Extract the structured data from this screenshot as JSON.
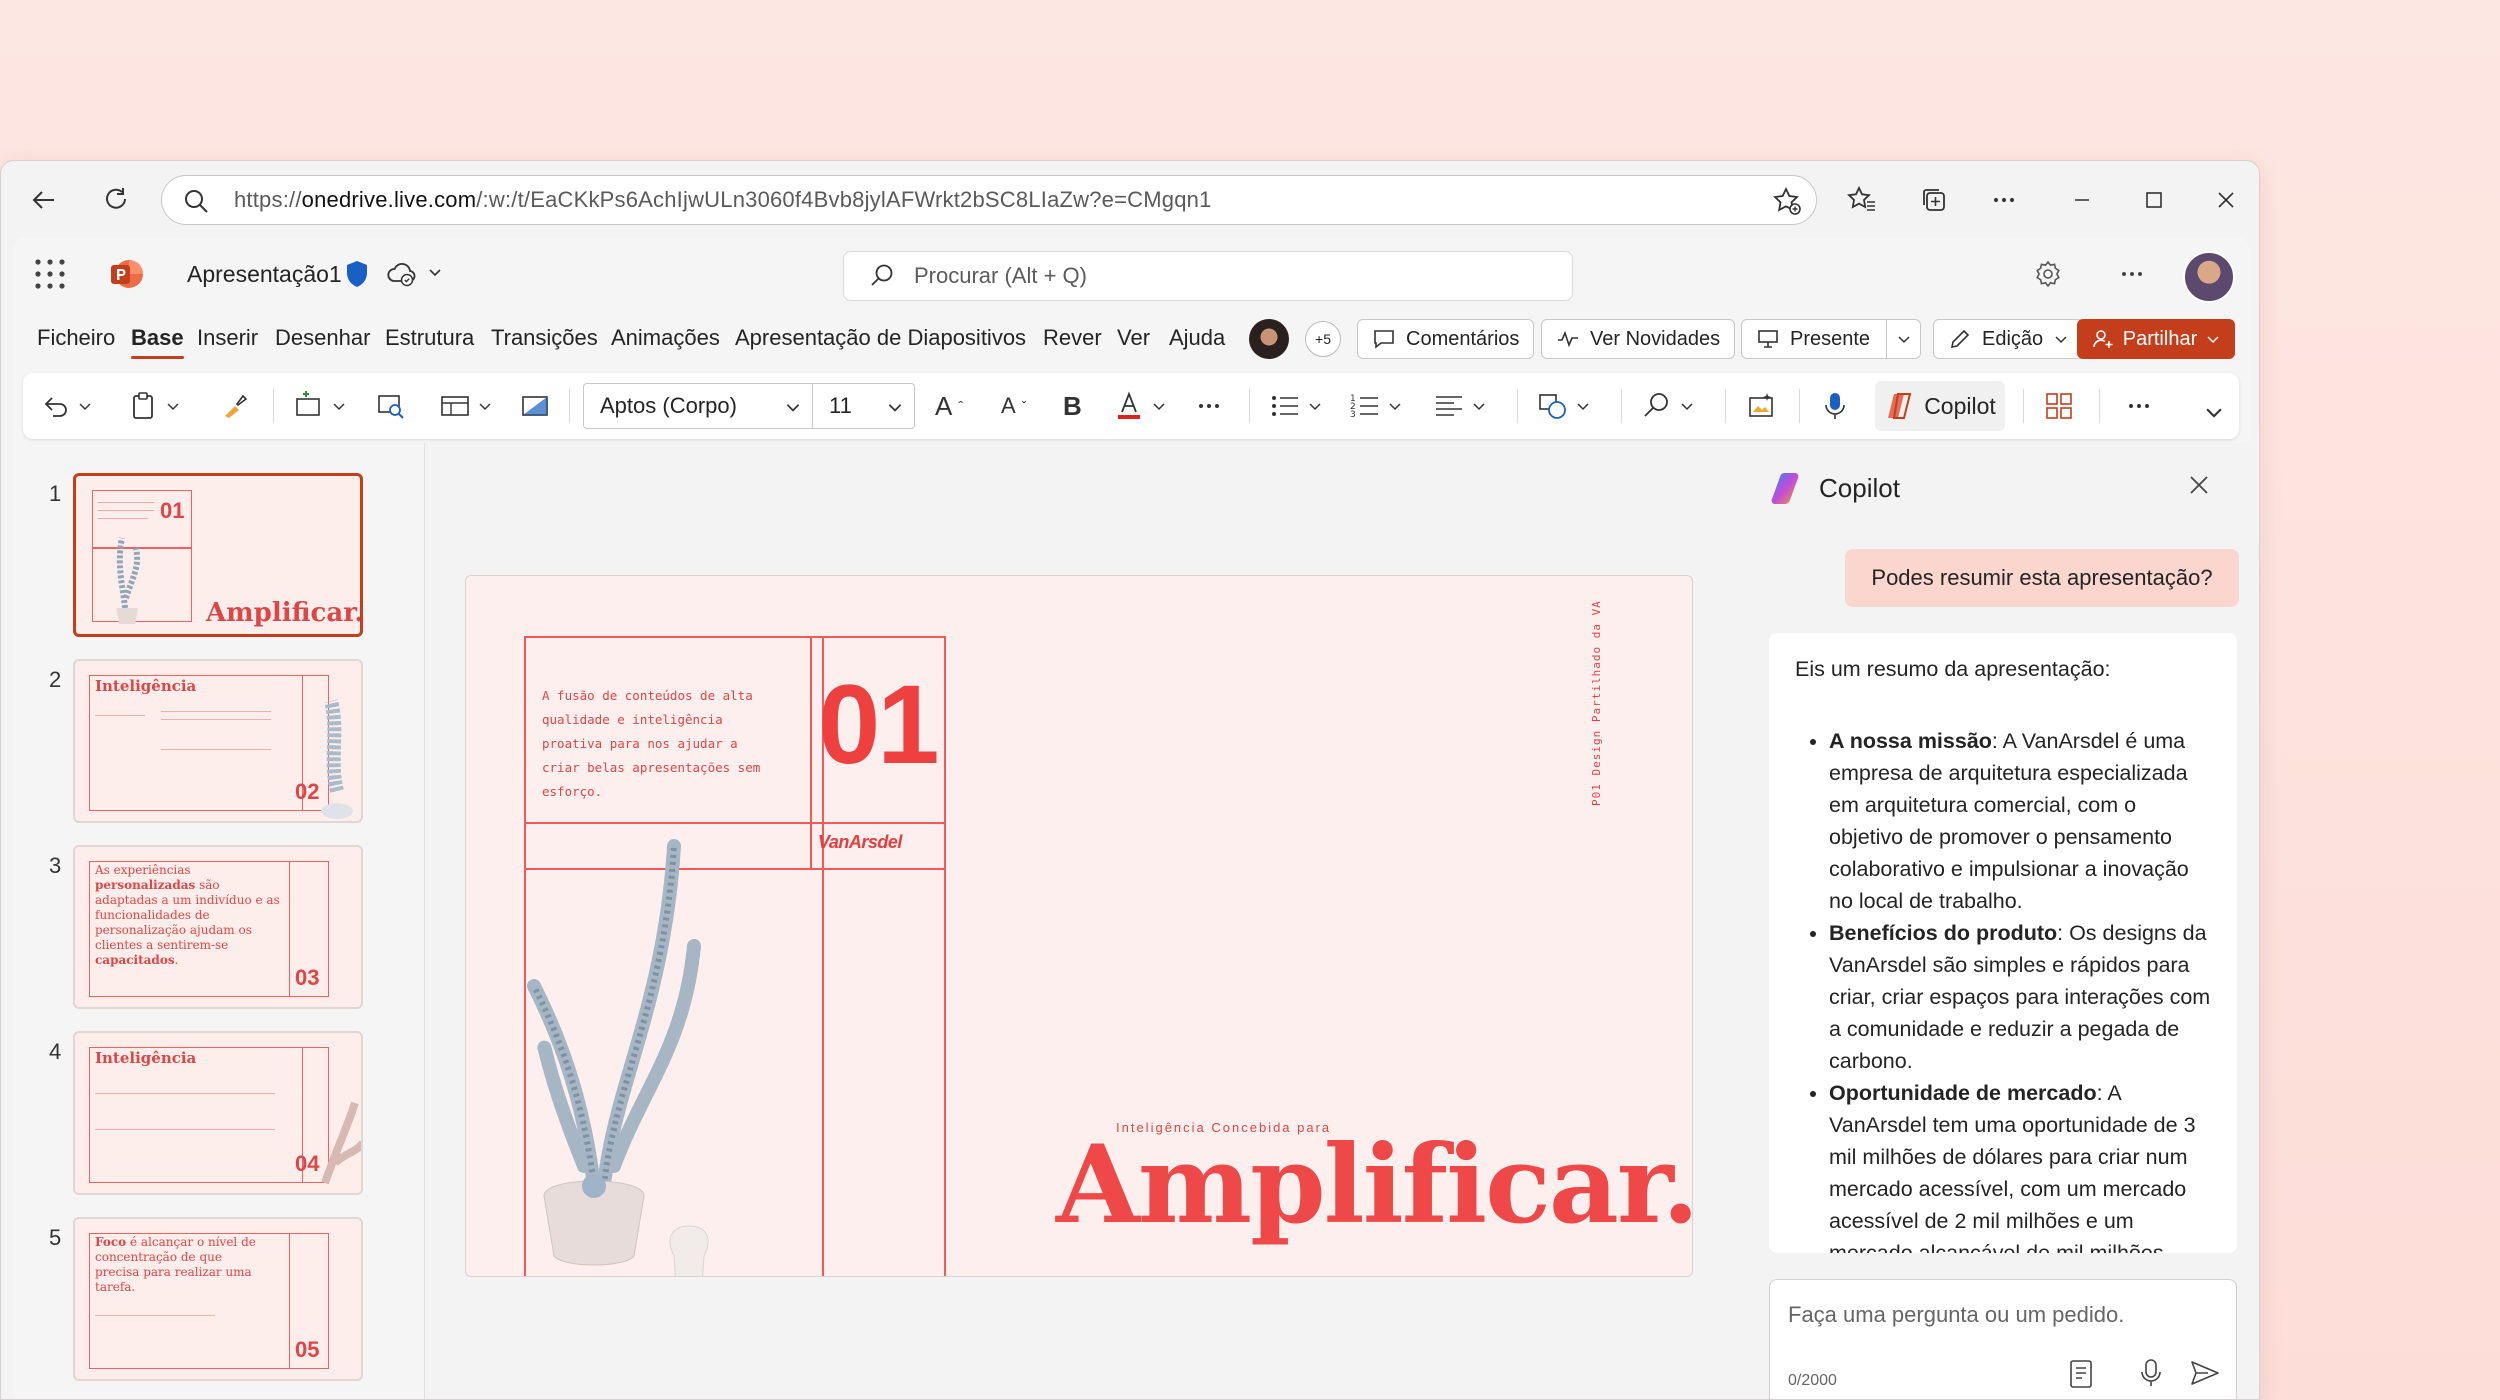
{
  "browser": {
    "url_prefix": "https://",
    "url_domain": "onedrive.live.com",
    "url_rest": "/:w:/t/EaCKkPs6AchIjwULn3060f4Bvb8jylAFWrkt2bSC8LIaZw?e=CMgqn1"
  },
  "header": {
    "doc_title": "Apresentação1",
    "search_placeholder": "Procurar (Alt + Q)"
  },
  "menu": {
    "items": [
      "Ficheiro",
      "Base",
      "Inserir",
      "Desenhar",
      "Estrutura",
      "Transições",
      "Animações",
      "Apresentação de Diapositivos",
      "Rever",
      "Ver",
      "Ajuda"
    ],
    "active": "Base",
    "collaborators_extra": "+5",
    "comments": "Comentários",
    "whats_new": "Ver Novidades",
    "present": "Presente",
    "editing": "Edição",
    "share": "Partilhar"
  },
  "toolbar": {
    "font": "Aptos (Corpo)",
    "size": "11",
    "copilot": "Copilot",
    "bold": "B",
    "grow": "A",
    "shrink": "A"
  },
  "thumbnails": [
    {
      "num": "1",
      "title": "Amplificar.",
      "badge": "01"
    },
    {
      "num": "2",
      "title": "Inteligência",
      "badge": "02"
    },
    {
      "num": "3",
      "text_a": "As experiências ",
      "text_b": "personalizadas",
      "text_c": " são adaptadas a um indivíduo e as funcionalidades de personalização ajudam os clientes a sentirem-se ",
      "text_d": "capacitados",
      "text_e": ".",
      "badge": "03"
    },
    {
      "num": "4",
      "title": "Inteligência",
      "badge": "04"
    },
    {
      "num": "5",
      "text_a": "Foco",
      "text_b": " é alcançar o nível de concentração de que precisa para realizar uma tarefa.",
      "badge": "05"
    }
  ],
  "slide": {
    "blurb": "A fusão de conteúdos de alta qualidade e inteligência proativa para nos ajudar a criar belas apresentações sem esforço.",
    "number": "01",
    "brand": "VanArsdel",
    "vertical": "P01   Design Partilhado da VA",
    "subtitle": "Inteligência Concebida para",
    "title": "Amplificar."
  },
  "copilot": {
    "title": "Copilot",
    "user_message": "Podes resumir esta apresentação?",
    "intro": "Eis um resumo da apresentação:",
    "bullets": [
      {
        "head": "A nossa missão",
        "body": ": A VanArsdel é uma empresa de arquitetura especializada em arquitetura comercial, com o objetivo de promover o pensamento colaborativo e impulsionar a inovação no local de trabalho."
      },
      {
        "head": "Benefícios do produto",
        "body": ": Os designs da VanArsdel são simples e rápidos para criar, criar espaços para interações com a comunidade e reduzir a pegada de carbono."
      },
      {
        "head": "Oportunidade de mercado",
        "body": ": A VanArsdel tem uma oportunidade de 3 mil milhões de dólares para criar num mercado acessível, com um mercado acessível de 2 mil milhões e um mercado alcançável de mil milhões."
      }
    ],
    "input_placeholder": "Faça uma pergunta ou um pedido.",
    "counter": "0/2000"
  },
  "colors": {
    "accent": "#c43e1c",
    "slide_red": "#ef4848",
    "slide_bg": "#fdefed"
  }
}
